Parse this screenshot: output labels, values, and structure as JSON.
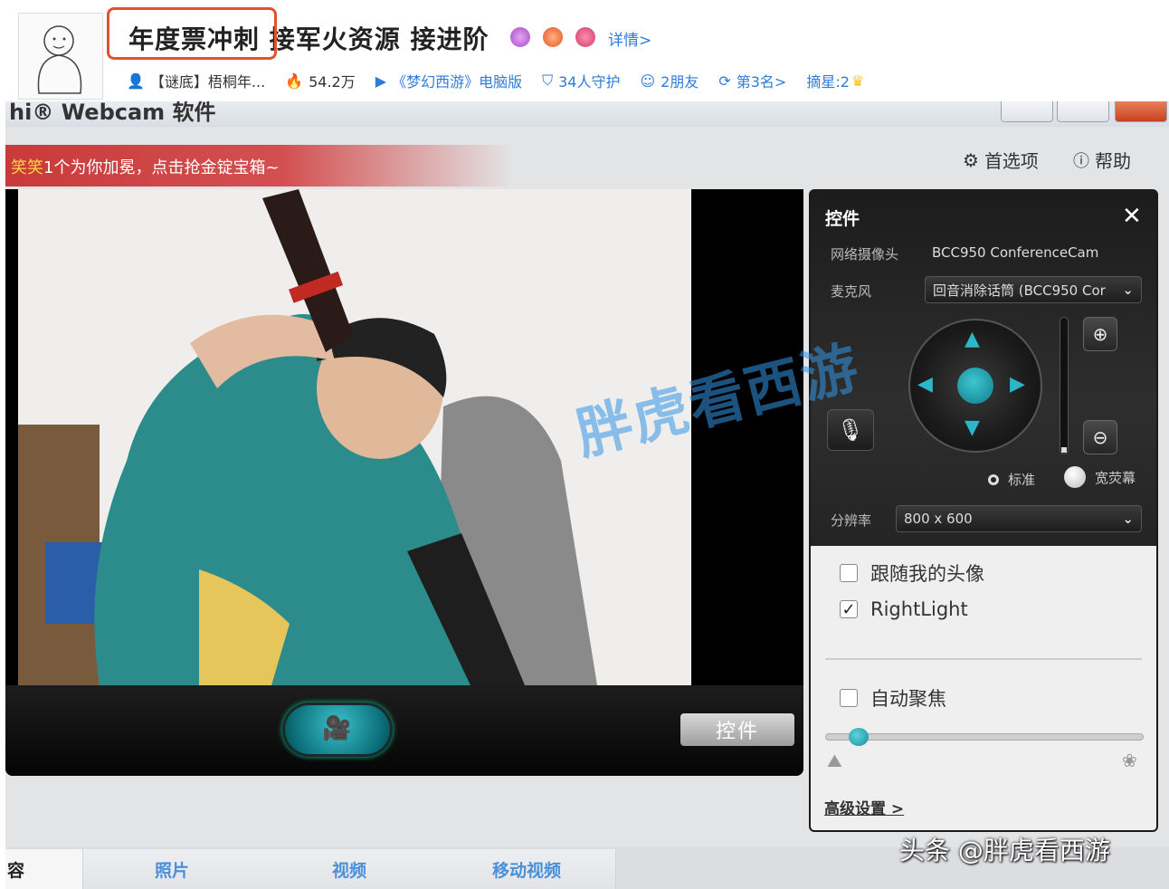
{
  "streamer": {
    "title": "年度票冲刺 接军火资源 接进阶",
    "detail_link": "详情>",
    "stats": {
      "user": "【谜底】梧桐年...",
      "heat": "54.2万",
      "game": "《梦幻西游》电脑版",
      "guardians": "34人守护",
      "friends": "2朋友",
      "rank": "第3名>",
      "stars": "摘星:2"
    }
  },
  "app": {
    "title": "hi® Webcam 软件",
    "preferences": "首选项",
    "help": "帮助",
    "banner_user": "笑笑",
    "banner_text": "1个为你加冕，点击抢金锭宝箱~",
    "record_button": "record",
    "controls_button": "控件"
  },
  "controls_panel": {
    "title": "控件",
    "camera_label": "网络摄像头",
    "camera_value": "BCC950 ConferenceCam",
    "mic_label": "麦克风",
    "mic_value": "回音消除话筒 (BCC950 Cor",
    "radio_standard": "标准",
    "radio_wide": "宽荧幕",
    "resolution_label": "分辨率",
    "resolution_value": "800 x 600",
    "follow_face": "跟随我的头像",
    "rightlight": "RightLight",
    "autofocus": "自动聚焦",
    "advanced": "高级设置 >"
  },
  "state": {
    "follow_face_checked": false,
    "rightlight_checked": true,
    "autofocus_checked": false,
    "focus_level": 0.1
  },
  "tabs": [
    "容",
    "照片",
    "视频",
    "移动视频"
  ],
  "watermark": "胖虎看西游",
  "credit": "头条 @胖虎看西游",
  "colors": {
    "accent": "#2bb7c7",
    "highlight_box": "#e0532c",
    "banner": "#c93a3a",
    "link": "#2f7bd8"
  }
}
